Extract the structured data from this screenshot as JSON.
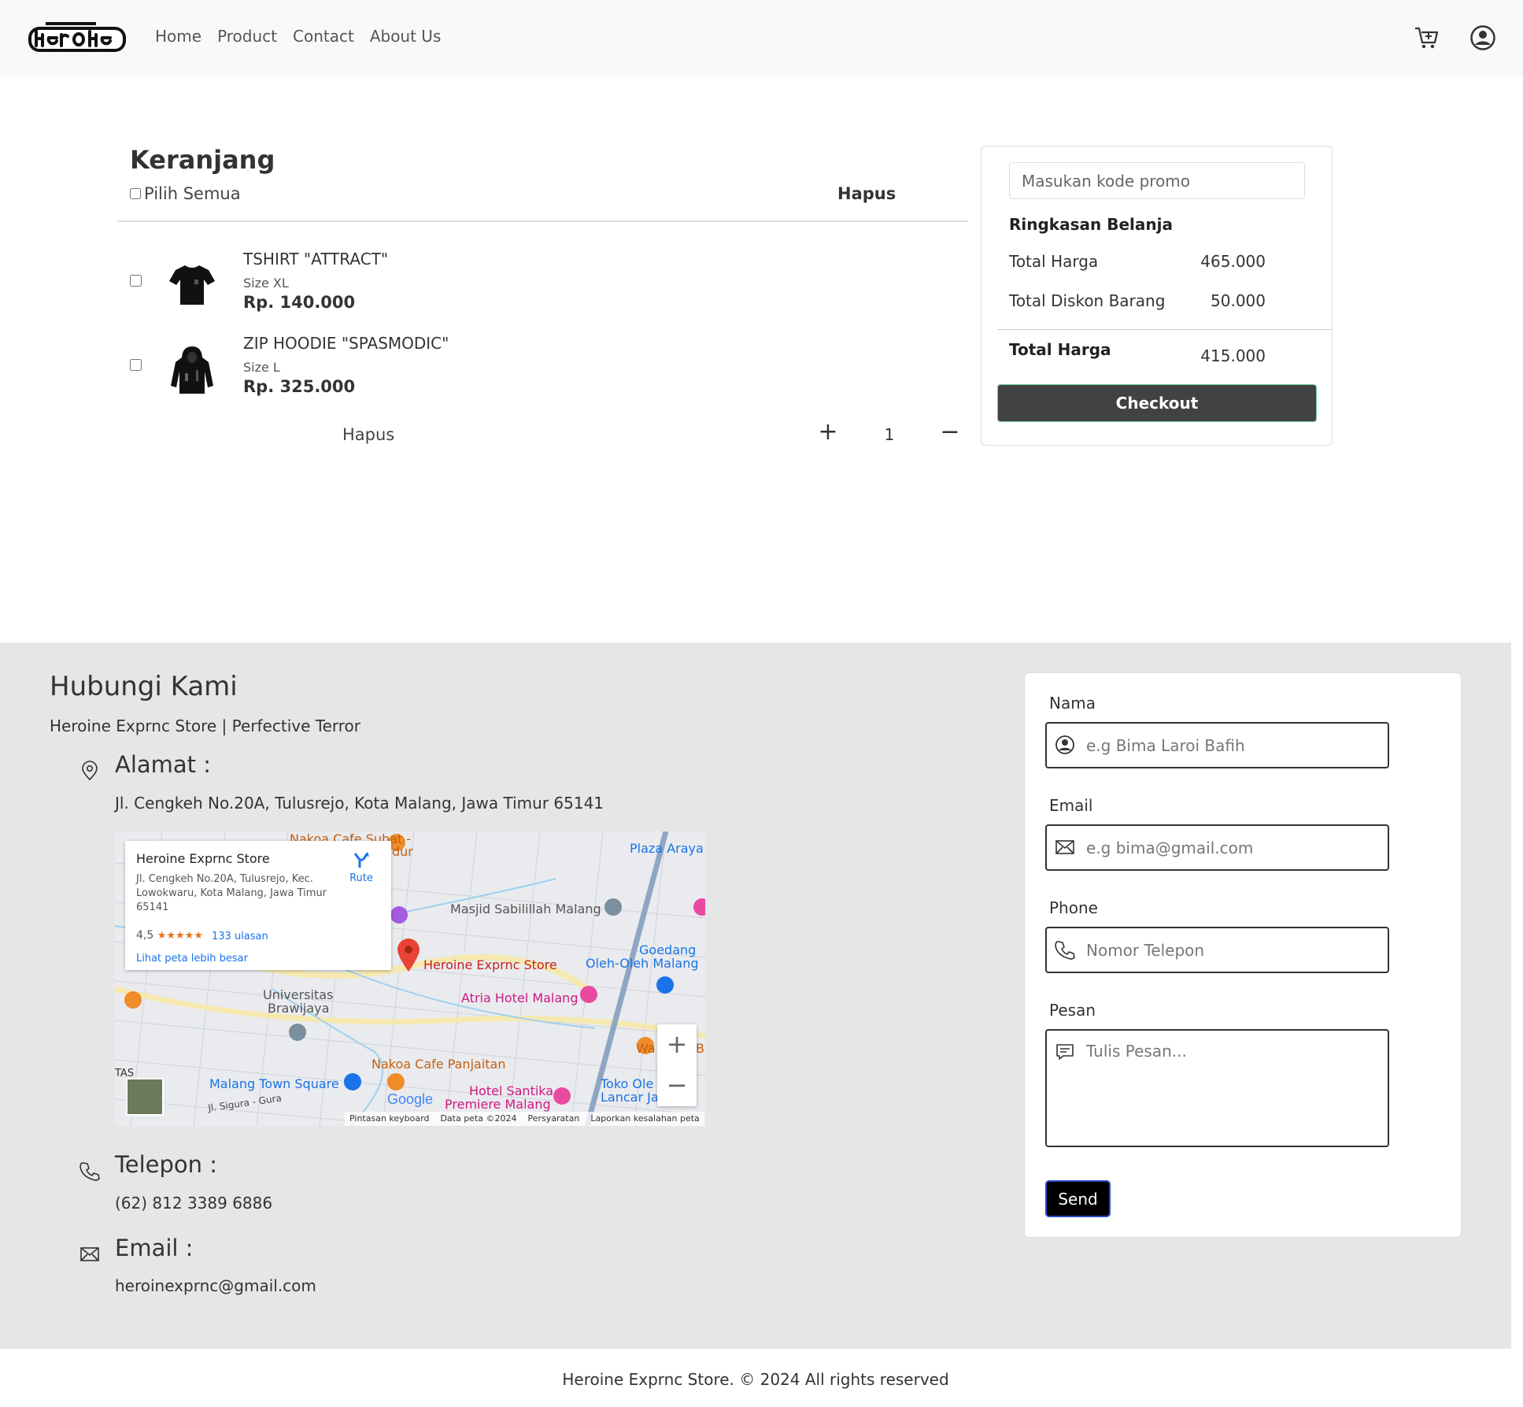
{
  "nav": {
    "links": [
      "Home",
      "Product",
      "Contact",
      "About Us"
    ]
  },
  "cart": {
    "title": "Keranjang",
    "select_all": "Pilih Semua",
    "delete_header": "Hapus",
    "items": [
      {
        "name": "TSHIRT \"ATTRACT\"",
        "size": "Size XL",
        "price": "Rp. 140.000",
        "image": "tshirt-icon"
      },
      {
        "name": "ZIP HOODIE \"SPASMODIC\"",
        "size": "Size L",
        "price": "Rp. 325.000",
        "image": "hoodie-icon"
      }
    ],
    "row_delete": "Hapus",
    "qty_plus": "+",
    "qty_value": "1",
    "qty_minus": "−"
  },
  "summary": {
    "promo_placeholder": "Masukan kode promo",
    "title": "Ringkasan Belanja",
    "rows": [
      {
        "label": "Total Harga",
        "value": "465.000"
      },
      {
        "label": "Total Diskon Barang",
        "value": "50.000"
      }
    ],
    "total_label": "Total Harga",
    "total_value": "415.000",
    "checkout": "Checkout"
  },
  "contact": {
    "title": "Hubungi Kami",
    "subtitle": "Heroine Exprnc Store | Perfective Terror",
    "address_head": "Alamat :",
    "address": "Jl. Cengkeh No.20A, Tulusrejo, Kota Malang, Jawa Timur 65141",
    "phone_head": "Telepon :",
    "phone": "(62) 812 3389 6886",
    "email_head": "Email :",
    "email": "heroinexprnc@gmail.com"
  },
  "map": {
    "card_title": "Heroine Exprnc Store",
    "card_address": "Jl. Cengkeh No.20A, Tulusrejo, Kec. Lowokwaru, Kota Malang, Jawa Timur 65141",
    "rating": "4,5",
    "stars": "★★★★★",
    "reviews": "133 ulasan",
    "larger_map": "Lihat peta lebih besar",
    "route": "Rute",
    "labels": {
      "cafe_suhat": "Nakoa Cafe Suhat -",
      "dur": "dur",
      "plaza": "Plaza Araya",
      "masjid": "Masjid Sabilillah Malang",
      "store": "Heroine Exprnc Store",
      "goedang": "Goedang",
      "oleh": "Oleh-Oleh Malang",
      "atria": "Atria Hotel Malang",
      "univ1": "Universitas",
      "univ2": "Brawijaya",
      "wa": "Wa",
      "b": "B",
      "cafe_panjaitan": "Nakoa Cafe Panjaitan",
      "tas": "TAS",
      "mts": "Malang Town Square",
      "toko1": "Toko Ole",
      "toko2": "Lancar Ja",
      "santika1": "Hotel Santika",
      "santika2": "Premiere Malang",
      "sigura": "Jl. Sigura - Gura",
      "google": "Google"
    },
    "attribution": [
      "Pintasan keyboard",
      "Data peta ©2024",
      "Persyaratan",
      "Laporkan kesalahan peta"
    ],
    "zoom_in": "+",
    "zoom_out": "−"
  },
  "form": {
    "name_label": "Nama",
    "name_placeholder": "e.g Bima Laroi Bafih",
    "email_label": "Email",
    "email_placeholder": "e.g bima@gmail.com",
    "phone_label": "Phone",
    "phone_placeholder": "Nomor Telepon",
    "message_label": "Pesan",
    "message_placeholder": "Tulis Pesan...",
    "send": "Send"
  },
  "footer": {
    "text": "Heroine Exprnc Store. © 2024 All rights reserved"
  },
  "colors": {
    "navbar_bg": "#f8f9fa",
    "contact_bg": "#e6e6e6",
    "checkout_bg": "#424242",
    "send_bg": "#000000"
  }
}
